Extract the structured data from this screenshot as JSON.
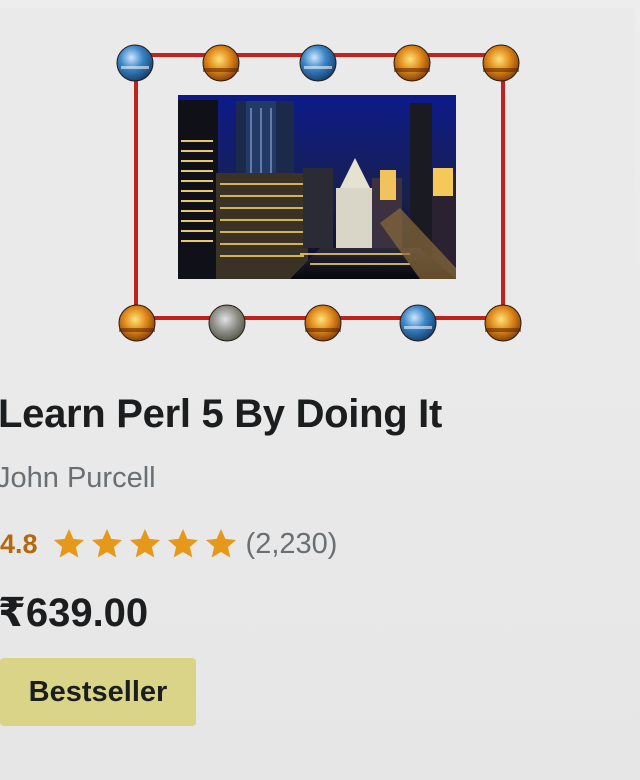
{
  "course": {
    "title": "Learn Perl 5 By Doing It",
    "author": "John Purcell",
    "rating": "4.8",
    "rating_fraction": 0.96,
    "review_count": "(2,230)",
    "price": "₹639.00",
    "badge": "Bestseller"
  },
  "colors": {
    "star": "#e59819",
    "rating_text": "#b4690e",
    "badge_bg": "#d9d488",
    "frame_line": "#c0221e",
    "title_text": "#1c1d1f",
    "muted_text": "#6a6f73"
  },
  "thumbnail": {
    "icon": "city-night-photo-icon",
    "top_orbs": [
      "blue",
      "sunset",
      "blue",
      "sunset",
      "sunset"
    ],
    "bottom_orbs": [
      "sunset",
      "rock",
      "sunset",
      "blue",
      "sunset"
    ]
  }
}
